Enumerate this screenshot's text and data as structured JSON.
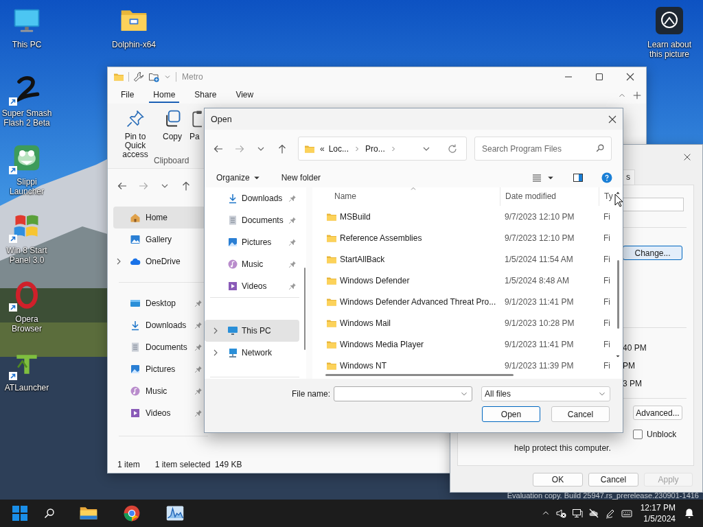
{
  "desktop": {
    "icons": [
      {
        "label": "This PC",
        "kind": "monitor",
        "shortcut": false
      },
      {
        "label": "Dolphin-x64",
        "kind": "folder",
        "shortcut": false
      },
      {
        "label": "Super Smash Flash 2 Beta",
        "kind": "swirl",
        "shortcut": true
      },
      {
        "label": "Slippi Launcher",
        "kind": "frog",
        "shortcut": true
      },
      {
        "label": "Win 8 Start Panel 3.0",
        "kind": "flag",
        "shortcut": true
      },
      {
        "label": "Opera Browser",
        "kind": "ring",
        "shortcut": true
      },
      {
        "label": "ATLauncher",
        "kind": "logo",
        "shortcut": true
      }
    ],
    "spotlight": {
      "label": "Learn about this picture"
    },
    "evaluation_notice": "Evaluation copy. Build 25947.rs_prerelease.230901-1416"
  },
  "explorer": {
    "title": "Metro",
    "ribbon_tabs": [
      {
        "label": "File",
        "selected": false
      },
      {
        "label": "Home",
        "selected": true
      },
      {
        "label": "Share",
        "selected": false
      },
      {
        "label": "View",
        "selected": false
      }
    ],
    "ribbon_commands": [
      {
        "label": "Pin to Quick access",
        "kind": "pin"
      },
      {
        "label": "Copy",
        "kind": "copy"
      },
      {
        "label": "Pa",
        "kind": "paste"
      }
    ],
    "ribbon_group": "Clipboard",
    "sidebar": {
      "groups": [
        {
          "items": [
            {
              "label": "Home",
              "kind": "home",
              "selected": true,
              "expandable": false,
              "pinned": false
            },
            {
              "label": "Gallery",
              "kind": "gallery",
              "selected": false,
              "expandable": false,
              "pinned": false
            },
            {
              "label": "OneDrive",
              "kind": "cloud",
              "selected": false,
              "expandable": true,
              "pinned": false
            }
          ]
        },
        {
          "items": [
            {
              "label": "Desktop",
              "kind": "desktop",
              "selected": false,
              "expandable": false,
              "pinned": true
            },
            {
              "label": "Downloads",
              "kind": "download",
              "selected": false,
              "expandable": false,
              "pinned": true
            },
            {
              "label": "Documents",
              "kind": "document",
              "selected": false,
              "expandable": false,
              "pinned": true
            },
            {
              "label": "Pictures",
              "kind": "picture",
              "selected": false,
              "expandable": false,
              "pinned": true
            },
            {
              "label": "Music",
              "kind": "music",
              "selected": false,
              "expandable": false,
              "pinned": true
            },
            {
              "label": "Videos",
              "kind": "video",
              "selected": false,
              "expandable": false,
              "pinned": true
            }
          ]
        }
      ]
    },
    "status_bar": {
      "item_count": "1 item",
      "selection": "1 item selected  149 KB"
    }
  },
  "properties": {
    "tab": "s",
    "change_button": "Change...",
    "times": [
      "40 PM",
      "PM",
      "3 PM"
    ],
    "advanced_button": "Advanced...",
    "unblock": {
      "label": "Unblock",
      "checked": false
    },
    "note": "help protect this computer.",
    "buttons": [
      {
        "label": "OK",
        "disabled": false
      },
      {
        "label": "Cancel",
        "disabled": false
      },
      {
        "label": "Apply",
        "disabled": true
      }
    ]
  },
  "open_dialog": {
    "title": "Open",
    "path_overflow": "«",
    "path": [
      "Loc...",
      "Pro..."
    ],
    "search": {
      "placeholder": "Search Program Files"
    },
    "commands": [
      "Organize",
      "New folder"
    ],
    "nav_pane": {
      "groups": [
        {
          "items": [
            {
              "label": "Downloads",
              "kind": "download",
              "selected": false,
              "expandable": false,
              "pinned": true
            },
            {
              "label": "Documents",
              "kind": "document",
              "selected": false,
              "expandable": false,
              "pinned": true
            },
            {
              "label": "Pictures",
              "kind": "picture",
              "selected": false,
              "expandable": false,
              "pinned": true
            },
            {
              "label": "Music",
              "kind": "music",
              "selected": false,
              "expandable": false,
              "pinned": true
            },
            {
              "label": "Videos",
              "kind": "video",
              "selected": false,
              "expandable": false,
              "pinned": true
            }
          ]
        },
        {
          "items": [
            {
              "label": "This PC",
              "kind": "pc",
              "selected": true,
              "expandable": true,
              "pinned": false
            },
            {
              "label": "Network",
              "kind": "network",
              "selected": false,
              "expandable": true,
              "pinned": false
            }
          ]
        }
      ]
    },
    "file_list": {
      "columns": [
        "Name",
        "Date modified",
        "Ty"
      ],
      "rows": [
        {
          "name": "MSBuild",
          "date": "9/7/2023 12:10 PM",
          "type": "Fi"
        },
        {
          "name": "Reference Assemblies",
          "date": "9/7/2023 12:10 PM",
          "type": "Fi"
        },
        {
          "name": "StartAllBack",
          "date": "1/5/2024 11:54 AM",
          "type": "Fi"
        },
        {
          "name": "Windows Defender",
          "date": "1/5/2024 8:48 AM",
          "type": "Fi"
        },
        {
          "name": "Windows Defender Advanced Threat Pro...",
          "date": "9/1/2023 11:41 PM",
          "type": "Fi"
        },
        {
          "name": "Windows Mail",
          "date": "9/1/2023 10:28 PM",
          "type": "Fi"
        },
        {
          "name": "Windows Media Player",
          "date": "9/1/2023 11:41 PM",
          "type": "Fi"
        },
        {
          "name": "Windows NT",
          "date": "9/1/2023 11:39 PM",
          "type": "Fi"
        }
      ]
    },
    "file_name_label": "File name:",
    "file_type": "All files",
    "buttons": [
      {
        "label": "Open",
        "default": true
      },
      {
        "label": "Cancel",
        "default": false
      }
    ]
  },
  "taskbar": {
    "apps": [
      {
        "kind": "folder"
      },
      {
        "kind": "browser"
      },
      {
        "kind": "monitor"
      }
    ],
    "clock": {
      "time": "12:17 PM",
      "date": "1/5/2024"
    }
  }
}
